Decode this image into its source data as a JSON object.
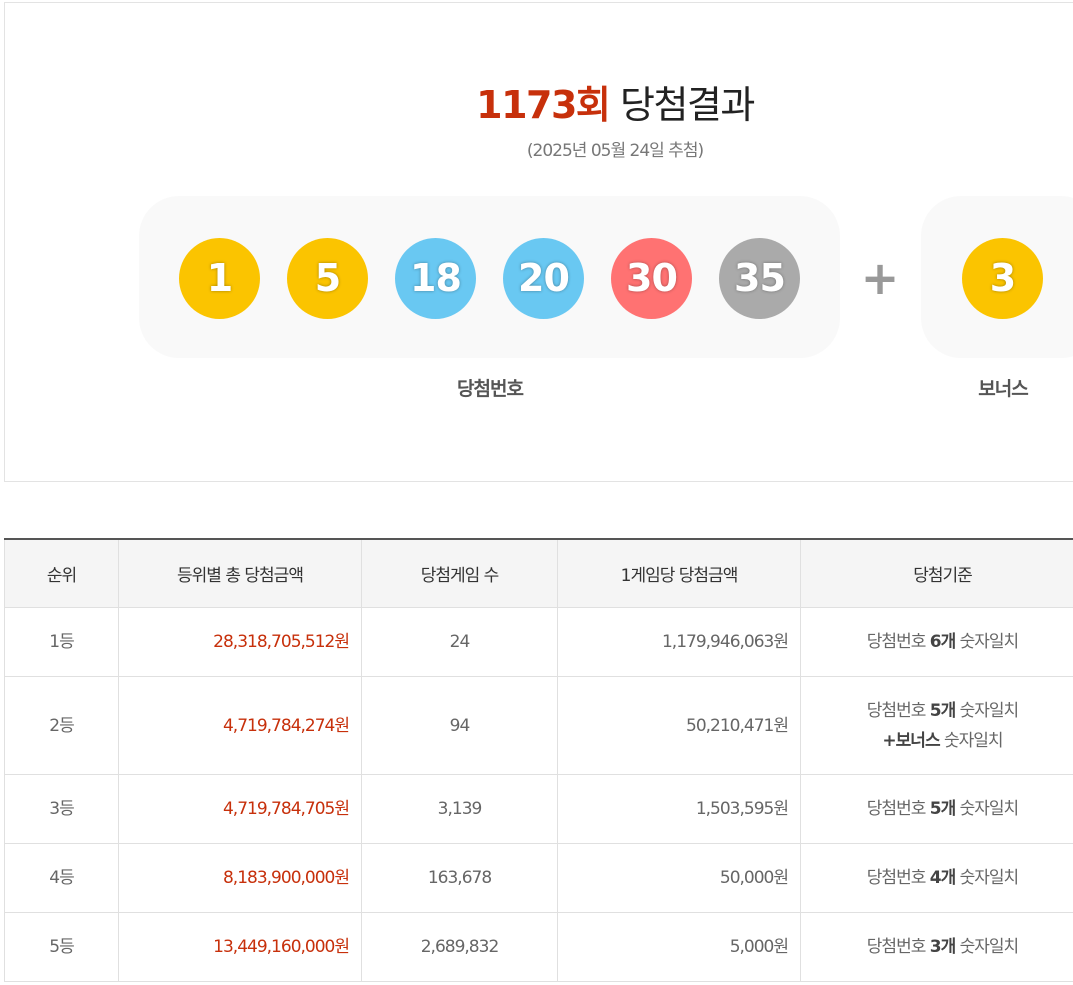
{
  "header": {
    "round": "1173회",
    "title_suffix": "당첨결과",
    "draw_date": "(2025년 05월 24일 추첨)"
  },
  "numbers": {
    "main": [
      {
        "value": "1",
        "color": "#fbc400"
      },
      {
        "value": "5",
        "color": "#fbc400"
      },
      {
        "value": "18",
        "color": "#69c8f2"
      },
      {
        "value": "20",
        "color": "#69c8f2"
      },
      {
        "value": "30",
        "color": "#ff7272"
      },
      {
        "value": "35",
        "color": "#aaaaaa"
      }
    ],
    "plus": "+",
    "bonus": {
      "value": "3",
      "color": "#fbc400"
    },
    "main_label": "당첨번호",
    "bonus_label": "보너스"
  },
  "table": {
    "headers": [
      "순위",
      "등위별 총 당첨금액",
      "당첨게임 수",
      "1게임당 당첨금액",
      "당첨기준"
    ],
    "rows": [
      {
        "rank": "1등",
        "total": "28,318,705,512원",
        "winners": "24",
        "per_game": "1,179,946,063원",
        "crit_prefix": "당첨번호 ",
        "crit_count": "6개",
        "crit_suffix": " 숫자일치"
      },
      {
        "rank": "2등",
        "total": "4,719,784,274원",
        "winners": "94",
        "per_game": "50,210,471원",
        "crit_prefix": "당첨번호 ",
        "crit_count": "5개",
        "crit_suffix": " 숫자일치",
        "crit_bonus": "+보너스",
        "crit_bonus_suffix": " 숫자일치"
      },
      {
        "rank": "3등",
        "total": "4,719,784,705원",
        "winners": "3,139",
        "per_game": "1,503,595원",
        "crit_prefix": "당첨번호 ",
        "crit_count": "5개",
        "crit_suffix": " 숫자일치"
      },
      {
        "rank": "4등",
        "total": "8,183,900,000원",
        "winners": "163,678",
        "per_game": "50,000원",
        "crit_prefix": "당첨번호 ",
        "crit_count": "4개",
        "crit_suffix": " 숫자일치"
      },
      {
        "rank": "5등",
        "total": "13,449,160,000원",
        "winners": "2,689,832",
        "per_game": "5,000원",
        "crit_prefix": "당첨번호 ",
        "crit_count": "3개",
        "crit_suffix": " 숫자일치"
      }
    ]
  },
  "colors": {
    "accent": "#c7300b",
    "panel_bg": "#f9f9f9",
    "header_bg": "#f5f5f5"
  }
}
